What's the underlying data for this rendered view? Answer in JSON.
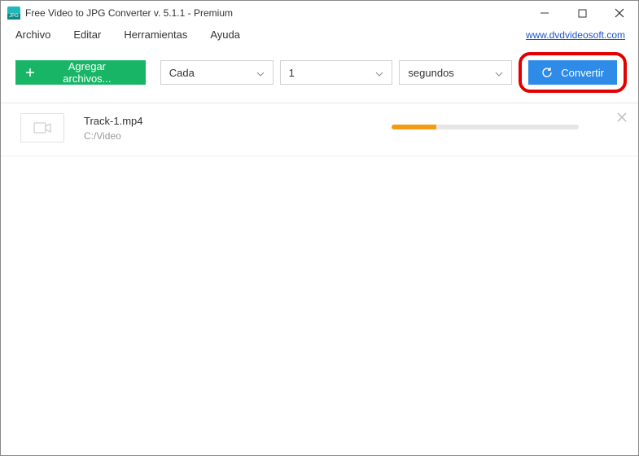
{
  "window": {
    "title": "Free Video to JPG Converter v. 5.1.1 - Premium"
  },
  "menu": {
    "file": "Archivo",
    "edit": "Editar",
    "tools": "Herramientas",
    "help": "Ayuda",
    "site_link": "www.dvdvideosoft.com"
  },
  "toolbar": {
    "add_files": "Agregar archivos...",
    "select_mode": "Cada",
    "select_value": "1",
    "select_unit": "segundos",
    "convert": "Convertir"
  },
  "list": {
    "items": [
      {
        "name": "Track-1.mp4",
        "path": "C:/Video",
        "progress_percent": 24
      }
    ]
  },
  "colors": {
    "accent_green": "#18b566",
    "accent_blue": "#2f8be8",
    "highlight_red": "#e20000",
    "progress_orange": "#f39c12"
  }
}
